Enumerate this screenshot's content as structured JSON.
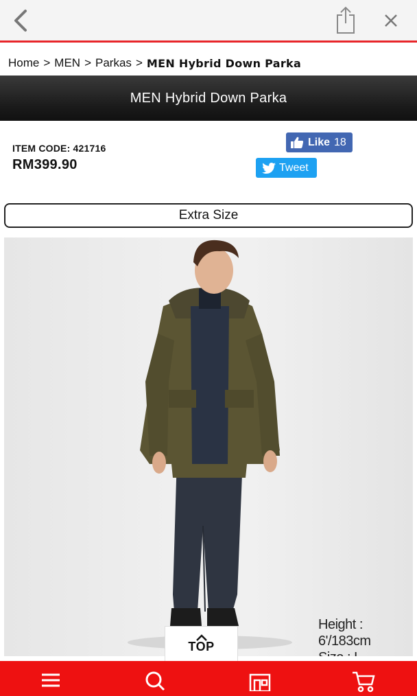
{
  "topbar": {
    "back_icon": "chevron-left-icon",
    "share_icon": "share-icon",
    "close_icon": "close-icon"
  },
  "breadcrumb": {
    "items": [
      "Home",
      "MEN",
      "Parkas"
    ],
    "separator": ">",
    "current": "MEN Hybrid Down Parka"
  },
  "product": {
    "title": "MEN Hybrid Down Parka",
    "item_code": "ITEM CODE: 421716",
    "price": "RM399.90",
    "extra_size_label": "Extra Size",
    "model_caption_line1": "Height : 6'/183cm",
    "model_caption_line2": "Size : L"
  },
  "social": {
    "like_label": "Like",
    "like_count": "18",
    "tweet_label": "Tweet",
    "facebook_color": "#4267b2",
    "twitter_color": "#1da1f2"
  },
  "top_button": {
    "label": "TOP",
    "icon": "chevron-up-icon"
  },
  "bottom_nav": {
    "background": "#ee1111",
    "items": [
      {
        "icon": "menu-icon"
      },
      {
        "icon": "search-icon"
      },
      {
        "icon": "store-icon"
      },
      {
        "icon": "cart-icon"
      }
    ]
  },
  "colors": {
    "accent": "#e8262a",
    "titlebar": "#1a1a1a"
  }
}
